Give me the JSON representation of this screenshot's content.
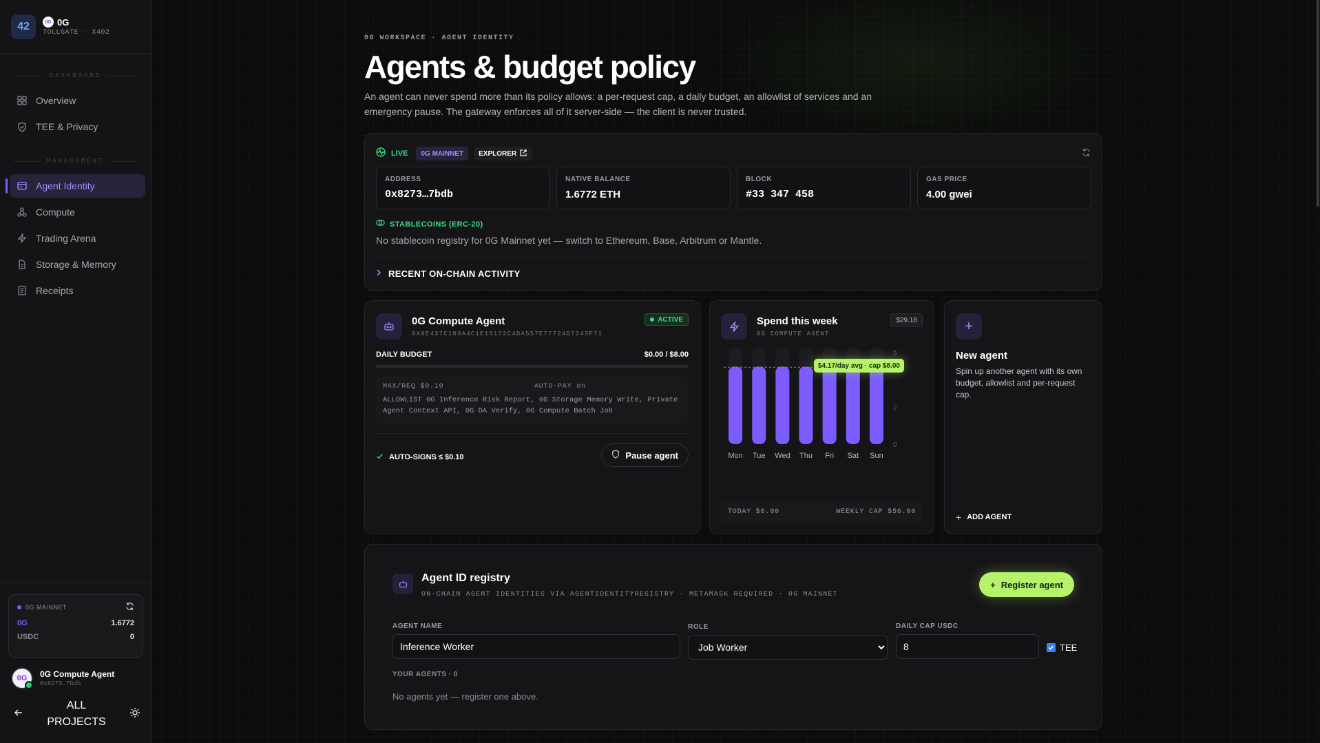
{
  "brand": {
    "name": "0G",
    "subtitle": "TOLLGATE · X402",
    "logo_text": "42",
    "og_mark": "0G"
  },
  "sidebar": {
    "section_dashboard": "DASHBOARD",
    "section_management": "MANAGEMENT",
    "dashboard_items": [
      {
        "label": "Overview",
        "icon": "grid-icon"
      },
      {
        "label": "TEE & Privacy",
        "icon": "shield-icon"
      }
    ],
    "management_items": [
      {
        "label": "Agent Identity",
        "icon": "id-card-icon",
        "active": true
      },
      {
        "label": "Compute",
        "icon": "nodes-icon"
      },
      {
        "label": "Trading Arena",
        "icon": "bolt-icon"
      },
      {
        "label": "Storage & Memory",
        "icon": "file-icon"
      },
      {
        "label": "Receipts",
        "icon": "receipt-icon"
      }
    ],
    "wallet": {
      "network": "0G MAINNET",
      "rows": [
        {
          "token": "0G",
          "value": "1.6772"
        },
        {
          "token": "USDC",
          "value": "0"
        }
      ]
    },
    "account": {
      "name": "0G Compute Agent",
      "address": "0x8273…7bdb",
      "avatar": "0G"
    },
    "footer": {
      "all_projects_line1": "ALL",
      "all_projects_line2": "PROJECTS"
    }
  },
  "page": {
    "breadcrumb": "0G WORKSPACE · AGENT IDENTITY",
    "title": "Agents & budget policy",
    "description": "An agent can never spend more than its policy allows: a per-request cap, a daily budget, an allowlist of services and an emergency pause. The gateway enforces all of it server-side — the client is never trusted."
  },
  "chain": {
    "live": "LIVE",
    "network": "0G MAINNET",
    "explorer": "EXPLORER",
    "stats": [
      {
        "label": "ADDRESS",
        "value": "0x8273…7bdb"
      },
      {
        "label": "NATIVE BALANCE",
        "value": "1.6772 ETH"
      },
      {
        "label": "BLOCK",
        "value": "#33 347 458"
      },
      {
        "label": "GAS PRICE",
        "value": "4.00 gwei"
      }
    ],
    "stablecoins_label": "STABLECOINS (ERC-20)",
    "stablecoins_note": "No stablecoin registry for 0G Mainnet yet — switch to Ethereum, Base, Arbitrum or Mantle.",
    "recent_activity": "RECENT ON-CHAIN ACTIVITY"
  },
  "agent": {
    "name": "0G Compute Agent",
    "address": "0X0E437C109A4C1E15172C4DA557E77724D7243F71",
    "status": "ACTIVE",
    "daily_budget_label": "DAILY BUDGET",
    "daily_budget_value": "$0.00 / $8.00",
    "budget_used_fraction": 0,
    "max_req": "MAX/REQ $0.10",
    "auto_pay": "AUTO-PAY on",
    "allowlist": "ALLOWLIST 0G Inference Risk Report, 0G Storage Memory Write, Private Agent Context API, 0G DA Verify, 0G Compute Batch Job",
    "auto_signs": "AUTO-SIGNS ≤ $0.10",
    "pause_button": "Pause agent"
  },
  "spend": {
    "title": "Spend this week",
    "subtitle": "0G COMPUTE AGENT",
    "total": "$29.18",
    "tooltip": "$4.17/day avg · cap $8.00",
    "today": "TODAY $0.00",
    "weekly_cap": "WEEKLY CAP $56.00"
  },
  "chart_data": {
    "type": "bar",
    "categories": [
      "Mon",
      "Tue",
      "Wed",
      "Thu",
      "Fri",
      "Sat",
      "Sun"
    ],
    "values": [
      4.2,
      4.2,
      4.2,
      4.2,
      4.2,
      4.2,
      4.2
    ],
    "ylim": [
      0,
      5
    ],
    "yticks": [
      "0",
      "2",
      "5"
    ],
    "cap_line": 4.17,
    "bar_color": "#7c5cff"
  },
  "new_agent": {
    "title": "New agent",
    "description": "Spin up another agent with its own budget, allowlist and per-request cap.",
    "add": "ADD AGENT"
  },
  "registry": {
    "title": "Agent ID registry",
    "subtitle": "ON-CHAIN AGENT IDENTITIES VIA AGENTIDENTITYREGISTRY · METAMASK REQUIRED · 0G MAINNET",
    "register_button": "Register agent",
    "name_label": "AGENT NAME",
    "name_value": "Inference Worker",
    "role_label": "ROLE",
    "role_value": "Job Worker",
    "cap_label": "DAILY CAP USDC",
    "cap_value": "8",
    "tee_label": "TEE",
    "your_agents": "YOUR AGENTS · 0",
    "empty": "No agents yet — register one above."
  },
  "colors": {
    "accent": "#7c5cff",
    "live_green": "#3ddc84",
    "button_green": "#b6f36a"
  }
}
